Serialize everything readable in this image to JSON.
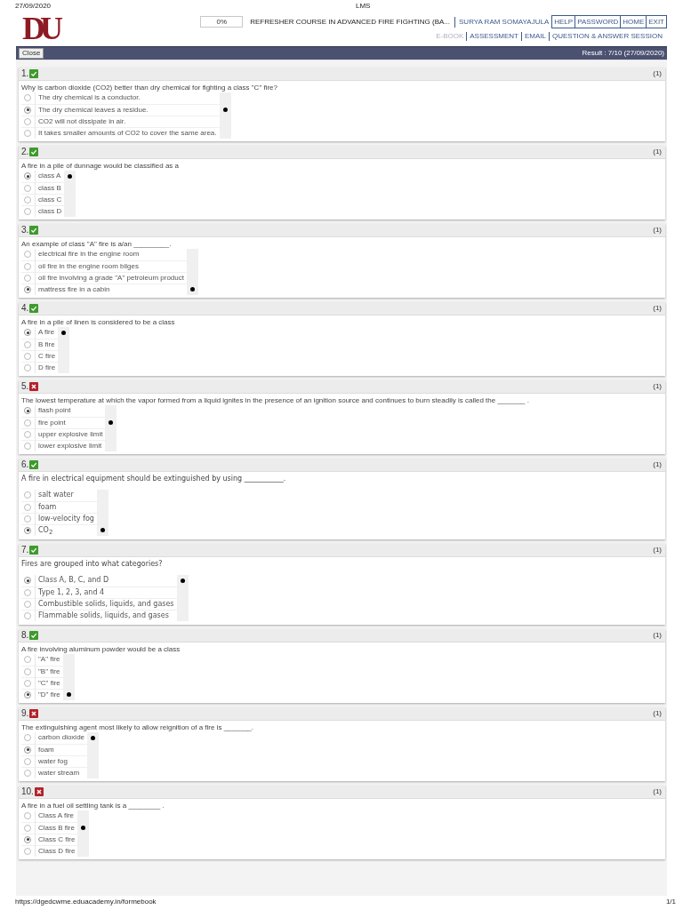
{
  "print_header": {
    "date": "27/09/2020",
    "title": "LMS"
  },
  "header": {
    "logo": "DU",
    "progress": {
      "level": 0,
      "reading": "0%"
    },
    "course_title": "REFRESHER COURSE IN ADVANCED FIRE FIGHTING (BA...",
    "user_name": "SURYA RAM SOMAYAJULA",
    "buttons": [
      "HELP",
      "PASSWORD",
      "HOME",
      "EXIT"
    ],
    "nav_links": [
      {
        "label": "E-BOOK",
        "disabled": true
      },
      {
        "label": "ASSESSMENT",
        "disabled": false
      },
      {
        "label": "EMAIL",
        "disabled": false
      },
      {
        "label": "QUESTION & ANSWER SESSION",
        "disabled": false
      }
    ]
  },
  "toolbar": {
    "close_button": "Close",
    "result": "Result : 7/10 (27/09/2020)"
  },
  "questions": [
    {
      "number": "1.",
      "correct": true,
      "marks": "(1)",
      "kind": "normal",
      "text": "Why is carbon dioxide (CO2) better than dry chemical for fighting a class \"C\" fire?",
      "options": [
        {
          "label": "The dry chemical is a conductor.",
          "selected": false,
          "answer": false
        },
        {
          "label": "The dry chemical leaves a residue.",
          "selected": true,
          "answer": true
        },
        {
          "label": "CO2 will not dissipate in air.",
          "selected": false,
          "answer": false
        },
        {
          "label": "It takes smaller amounts of CO2 to cover the same area.",
          "selected": false,
          "answer": false
        }
      ]
    },
    {
      "number": "2.",
      "correct": true,
      "marks": "(1)",
      "kind": "normal",
      "text": "A fire in a pile of dunnage would be classified as a",
      "options": [
        {
          "label": "class A",
          "selected": true,
          "answer": true
        },
        {
          "label": "class B",
          "selected": false,
          "answer": false
        },
        {
          "label": "class C",
          "selected": false,
          "answer": false
        },
        {
          "label": "class D",
          "selected": false,
          "answer": false
        }
      ]
    },
    {
      "number": "3.",
      "correct": true,
      "marks": "(1)",
      "kind": "normal",
      "text": "An example of class \"A\" fire is a/an _________.",
      "options": [
        {
          "label": "electrical fire in the engine room",
          "selected": false,
          "answer": false
        },
        {
          "label": "oil fire in the engine room bilges",
          "selected": false,
          "answer": false
        },
        {
          "label": "oil fire involving a grade \"A\" petroleum product",
          "selected": false,
          "answer": false
        },
        {
          "label": "mattress fire in a cabin",
          "selected": true,
          "answer": true
        }
      ]
    },
    {
      "number": "4.",
      "correct": true,
      "marks": "(1)",
      "kind": "normal",
      "text": "A fire in a pile of linen is considered to be a class",
      "options": [
        {
          "label": "A fire",
          "selected": true,
          "answer": true
        },
        {
          "label": "B fire",
          "selected": false,
          "answer": false
        },
        {
          "label": "C fire",
          "selected": false,
          "answer": false
        },
        {
          "label": "D fire",
          "selected": false,
          "answer": false
        }
      ]
    },
    {
      "number": "5.",
      "correct": false,
      "marks": "(1)",
      "kind": "normal",
      "text": "The lowest temperature at which the vapor formed from a liquid ignites in the presence of an ignition source and continues to burn steadily is called the _______ .",
      "options": [
        {
          "label": "flash point",
          "selected": true,
          "answer": false
        },
        {
          "label": "fire point",
          "selected": false,
          "answer": true
        },
        {
          "label": "upper explosive limit",
          "selected": false,
          "answer": false
        },
        {
          "label": "lower explosive limit",
          "selected": false,
          "answer": false
        }
      ]
    },
    {
      "number": "6.",
      "correct": true,
      "marks": "(1)",
      "kind": "wide",
      "text": "A fire in electrical equipment should be extinguished by using ___________.",
      "options": [
        {
          "label": "salt water",
          "selected": false,
          "answer": false
        },
        {
          "label": "foam",
          "selected": false,
          "answer": false
        },
        {
          "label": "low-velocity fog",
          "selected": false,
          "answer": false
        },
        {
          "label": "CO$_{2}$",
          "selected": true,
          "answer": true
        }
      ]
    },
    {
      "number": "7.",
      "correct": true,
      "marks": "(1)",
      "kind": "wide",
      "text": "Fires are grouped into what categories?",
      "options": [
        {
          "label": "Class A, B, C, and D",
          "selected": true,
          "answer": true
        },
        {
          "label": "Type 1, 2, 3, and 4",
          "selected": false,
          "answer": false
        },
        {
          "label": "Combustible solids, liquids, and gases",
          "selected": false,
          "answer": false
        },
        {
          "label": "Flammable solids, liquids, and gases",
          "selected": false,
          "answer": false
        }
      ]
    },
    {
      "number": "8.",
      "correct": true,
      "marks": "(1)",
      "kind": "normal",
      "text": "A fire involving aluminum powder would be a class",
      "options": [
        {
          "label": "\"A\" fire",
          "selected": false,
          "answer": false
        },
        {
          "label": "\"B\" fire",
          "selected": false,
          "answer": false
        },
        {
          "label": "\"C\" fire",
          "selected": false,
          "answer": false
        },
        {
          "label": "\"D\" fire",
          "selected": true,
          "answer": true
        }
      ]
    },
    {
      "number": "9.",
      "correct": false,
      "marks": "(1)",
      "kind": "normal",
      "text": "The extinguishing agent most likely to allow reignition of a fire is _______.",
      "options": [
        {
          "label": "carbon dioxide",
          "selected": false,
          "answer": true
        },
        {
          "label": "foam",
          "selected": true,
          "answer": false
        },
        {
          "label": "water fog",
          "selected": false,
          "answer": false
        },
        {
          "label": "water stream",
          "selected": false,
          "answer": false
        }
      ]
    },
    {
      "number": "10.",
      "correct": false,
      "marks": "(1)",
      "kind": "normal",
      "text": "A fire in a fuel oil settling tank is a ________ .",
      "options": [
        {
          "label": "Class A fire",
          "selected": false,
          "answer": false
        },
        {
          "label": "Class B fire",
          "selected": false,
          "answer": true
        },
        {
          "label": "Class C fire",
          "selected": true,
          "answer": false
        },
        {
          "label": "Class D fire",
          "selected": false,
          "answer": false
        }
      ]
    }
  ],
  "footer": {
    "url": "https://dgedcwme.eduacademy.in/formebook",
    "page": "1/1"
  }
}
